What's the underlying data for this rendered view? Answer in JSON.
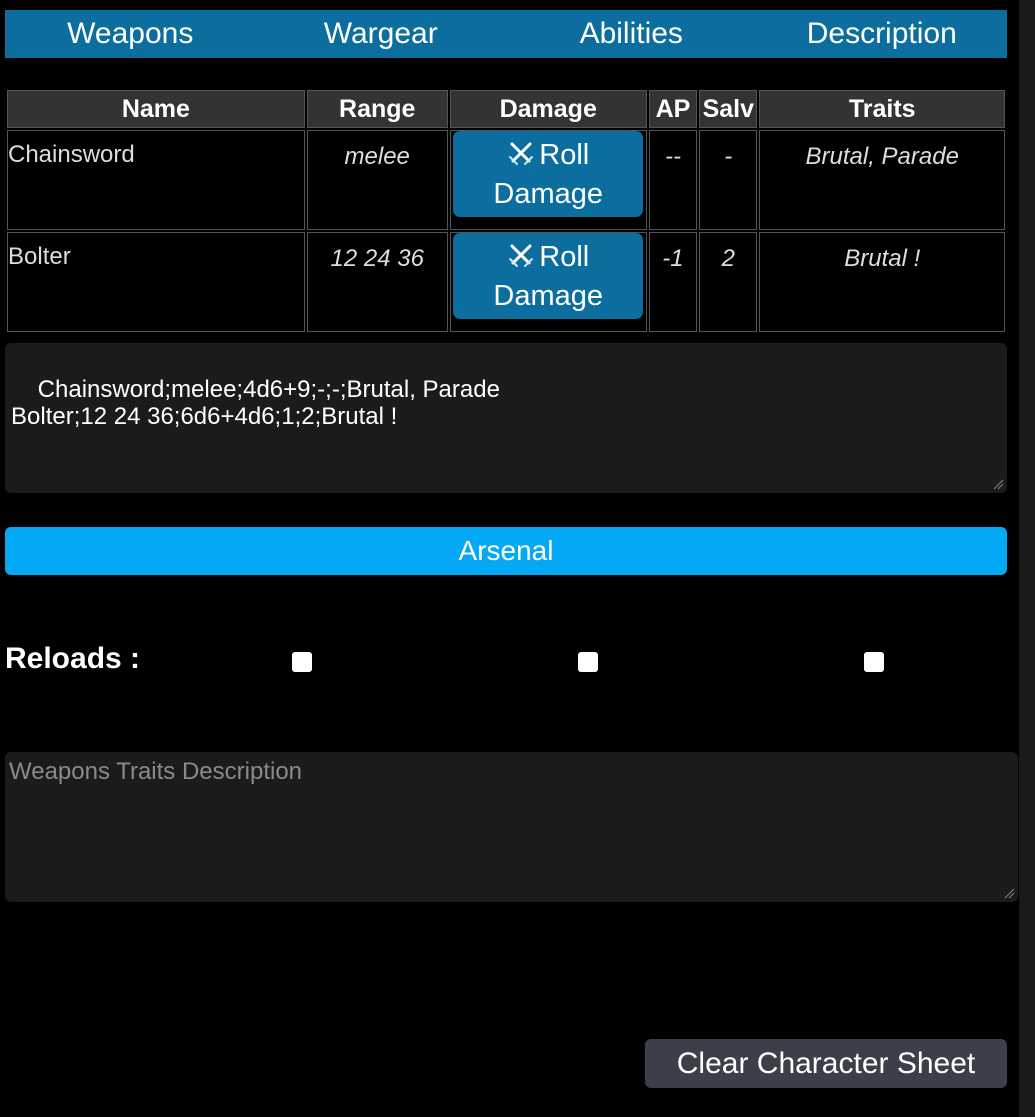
{
  "tabs": [
    "Weapons",
    "Wargear",
    "Abilities",
    "Description"
  ],
  "table": {
    "headers": [
      "Name",
      "Range",
      "Damage",
      "AP",
      "Salv",
      "Traits"
    ],
    "rows": [
      {
        "name": "Chainsword",
        "range": "melee",
        "damage_button": {
          "icon": "crossed-swords-icon",
          "line1": "Roll",
          "line2": "Damage"
        },
        "ap": "--",
        "salv": "-",
        "traits": "Brutal, Parade"
      },
      {
        "name": "Bolter",
        "range": "12 24 36",
        "damage_button": {
          "icon": "crossed-swords-icon",
          "line1": "Roll",
          "line2": "Damage"
        },
        "ap": "-1",
        "salv": "2",
        "traits": "Brutal !"
      }
    ]
  },
  "import_text": "Chainsword;melee;4d6+9;-;-;Brutal, Parade\nBolter;12 24 36;6d6+4d6;1;2;Brutal !",
  "arsenal_label": "Arsenal",
  "reloads": {
    "label": "Reloads :",
    "checkboxes": [
      false,
      false,
      false
    ]
  },
  "traits_description": {
    "placeholder": "Weapons Traits Description",
    "value": ""
  },
  "clear_button_label": "Clear Character Sheet",
  "colors": {
    "tab_bar": "#0b6e9f",
    "arsenal": "#03a9f4",
    "clear_button": "#3a3f4a"
  }
}
